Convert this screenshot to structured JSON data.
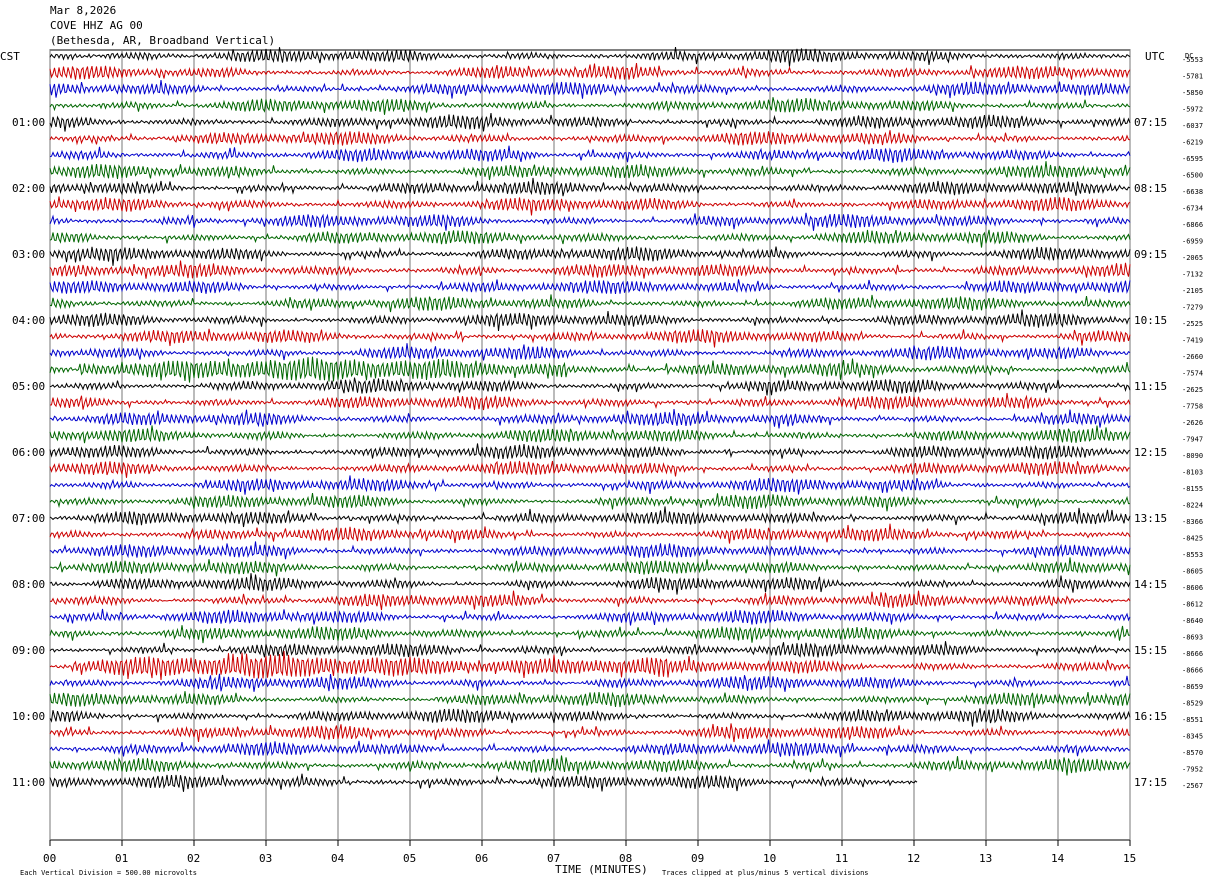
{
  "header": {
    "date": "Mar 8,2026",
    "station": "COVE HHZ AG 00",
    "location": "(Bethesda, AR, Broadband Vertical)"
  },
  "left_timezone": "CST",
  "right_timezone": "UTC",
  "footer": {
    "scale_note": "Each Vertical Division =  500.00 microvolts",
    "xaxis_title": "TIME (MINUTES)",
    "clip_note": "Traces clipped at plus/minus 5 vertical divisions"
  },
  "chart_data": {
    "type": "line",
    "subtype": "helicorder",
    "xlabel": "TIME (MINUTES)",
    "x_ticks": [
      "00",
      "01",
      "02",
      "03",
      "04",
      "05",
      "06",
      "07",
      "08",
      "09",
      "10",
      "11",
      "12",
      "13",
      "14",
      "15"
    ],
    "xlim": [
      0,
      15
    ],
    "lines_per_hour": 4,
    "minutes_per_line": 15,
    "trace_colors": [
      "#000000",
      "#cc0000",
      "#0000cc",
      "#006600"
    ],
    "grid": "vertical lines each minute",
    "left_hour_labels": [
      "01:00",
      "02:00",
      "03:00",
      "04:00",
      "05:00",
      "06:00",
      "07:00",
      "08:00",
      "09:00",
      "10:00",
      "11:00"
    ],
    "right_hour_labels": [
      "07:15",
      "08:15",
      "09:15",
      "10:15",
      "11:15",
      "12:15",
      "13:15",
      "14:15",
      "15:15",
      "16:15",
      "17:15"
    ],
    "right_offsets": [
      "-5553",
      "-5781",
      "-5850",
      "-5972",
      "-6037",
      "-6219",
      "-6595",
      "-6500",
      "-6638",
      "-6734",
      "-6866",
      "-6959",
      "-2065",
      "-7132",
      "-2105",
      "-7279",
      "-2525",
      "-7419",
      "-2660",
      "-7574",
      "-2625",
      "-7758",
      "-2626",
      "-7947",
      "-8090",
      "-8103",
      "-8155",
      "-8224",
      "-8366",
      "-8425",
      "-8553",
      "-8605",
      "-8606",
      "-8612",
      "-8640",
      "-8693",
      "-8666",
      "-8666",
      "-8659",
      "-8529",
      "-8551",
      "-8345",
      "-8570",
      "-7952",
      "-2567"
    ],
    "first_offset_label": "DC",
    "last_trace_end_minute": 12.05,
    "active_segments": [
      {
        "line": 19,
        "from": 0.4,
        "to": 7.2
      },
      {
        "line": 37,
        "from": 0.3,
        "to": 8.6
      }
    ]
  }
}
